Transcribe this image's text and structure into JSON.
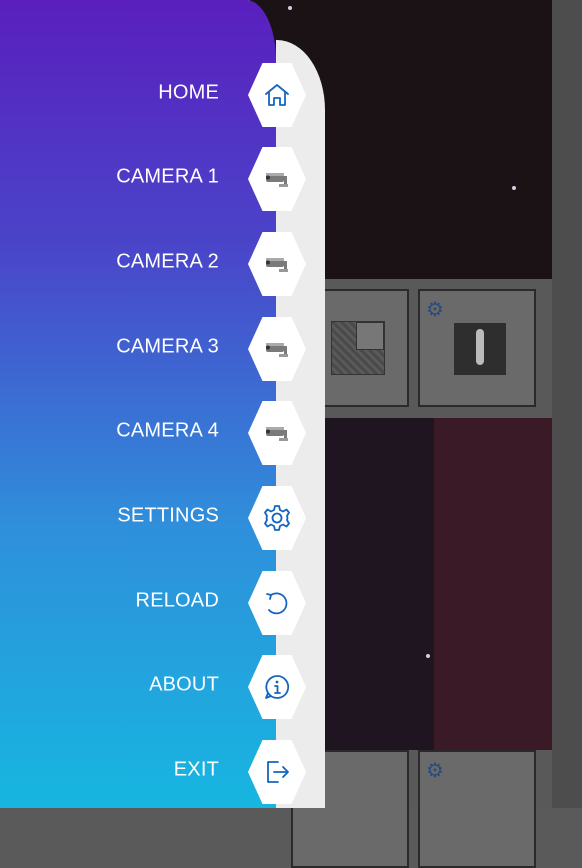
{
  "app": {
    "menu_items": [
      {
        "id": "home",
        "label": "HOME",
        "icon": "home-icon"
      },
      {
        "id": "camera-1",
        "label": "CAMERA 1",
        "icon": "security-camera-icon"
      },
      {
        "id": "camera-2",
        "label": "CAMERA 2",
        "icon": "security-camera-icon"
      },
      {
        "id": "camera-3",
        "label": "CAMERA 3",
        "icon": "security-camera-icon"
      },
      {
        "id": "camera-4",
        "label": "CAMERA 4",
        "icon": "security-camera-icon"
      },
      {
        "id": "settings",
        "label": "SETTINGS",
        "icon": "gear-icon"
      },
      {
        "id": "reload",
        "label": "RELOAD",
        "icon": "reload-icon"
      },
      {
        "id": "about",
        "label": "ABOUT",
        "icon": "info-icon"
      },
      {
        "id": "exit",
        "label": "EXIT",
        "icon": "exit-icon"
      }
    ]
  },
  "colors": {
    "drawer_gradient_top": "#5a1fbe",
    "drawer_gradient_bottom": "#17b6e0",
    "icon_stroke": "#1565c0",
    "rail": "#ececec"
  }
}
